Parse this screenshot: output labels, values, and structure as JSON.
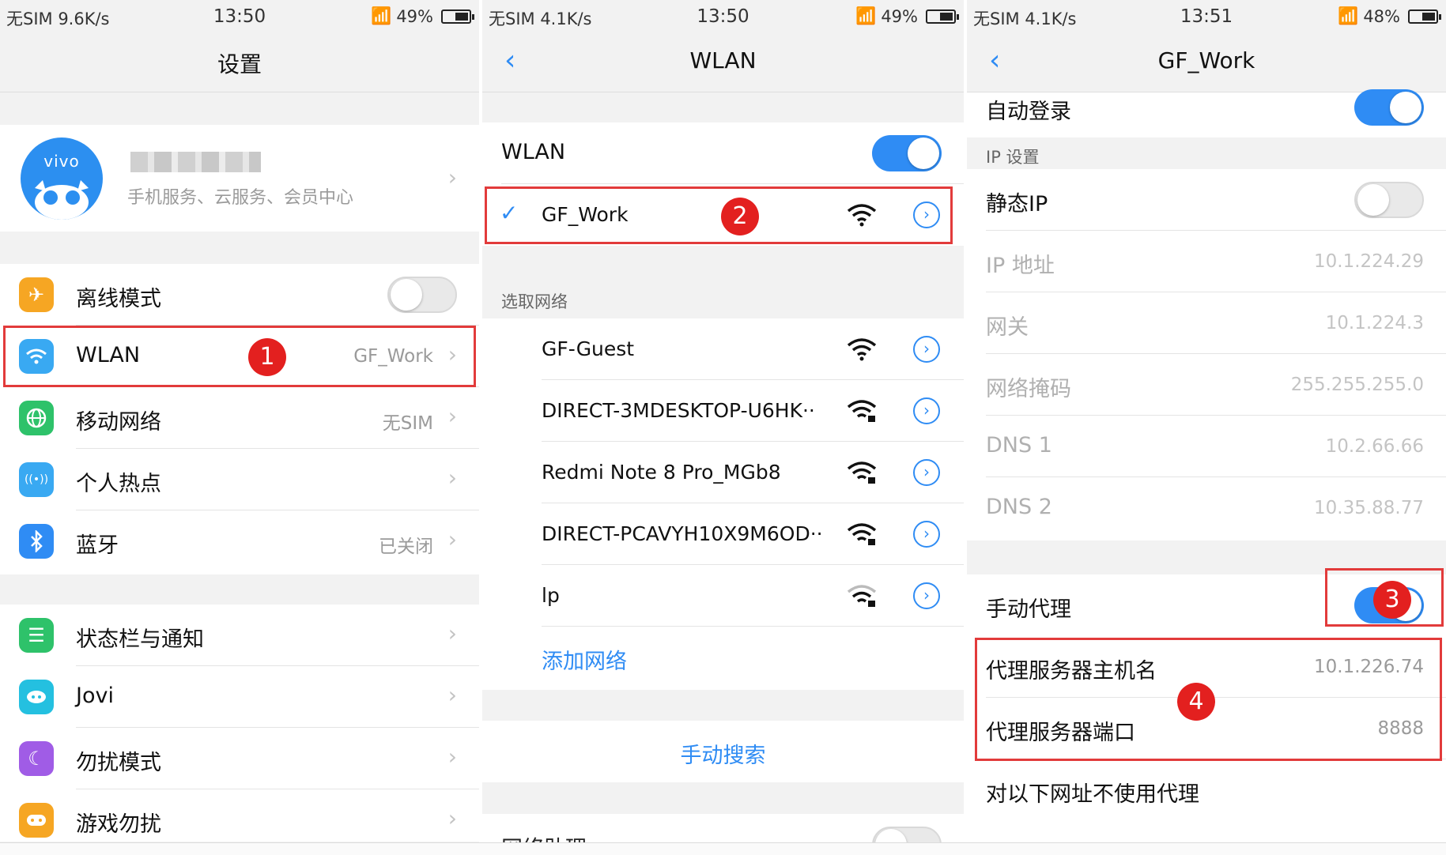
{
  "colors": {
    "accent": "#2f8cf4",
    "marker": "#e3201f",
    "outline": "#e23b3b"
  },
  "panel1": {
    "status": {
      "left": "无SIM 9.6K/s",
      "time": "13:50",
      "battery": "49%"
    },
    "title": "设置",
    "account": {
      "brand": "vivo",
      "subtitle": "手机服务、云服务、会员中心"
    },
    "items": [
      {
        "label": "离线模式",
        "icon": "airplane-icon"
      },
      {
        "label": "WLAN",
        "value": "GF_Work",
        "icon": "wifi-icon"
      },
      {
        "label": "移动网络",
        "value": "无SIM",
        "icon": "globe-icon"
      },
      {
        "label": "个人热点",
        "icon": "hotspot-icon"
      },
      {
        "label": "蓝牙",
        "value": "已关闭",
        "icon": "bluetooth-icon"
      },
      {
        "label": "状态栏与通知",
        "icon": "notification-icon"
      },
      {
        "label": "Jovi",
        "icon": "jovi-icon"
      },
      {
        "label": "勿扰模式",
        "icon": "moon-icon"
      },
      {
        "label": "游戏勿扰",
        "icon": "game-icon"
      }
    ],
    "badge": "1"
  },
  "panel2": {
    "status": {
      "left": "无SIM 4.1K/s",
      "time": "13:50",
      "battery": "49%"
    },
    "title": "WLAN",
    "wlan_label": "WLAN",
    "connected": "GF_Work",
    "section": "选取网络",
    "networks": [
      "GF-Guest",
      "DIRECT-3MDESKTOP-U6HK··",
      "Redmi Note 8 Pro_MGb8",
      "DIRECT-PCAVYH10X9M6OD··",
      "lp"
    ],
    "add_network": "添加网络",
    "manual_search": "手动搜索",
    "assistant": "网络助理",
    "badge": "2"
  },
  "panel3": {
    "status": {
      "left": "无SIM 4.1K/s",
      "time": "13:51",
      "battery": "48%"
    },
    "title": "GF_Work",
    "auto_login": "自动登录",
    "ip_section": "IP 设置",
    "static_ip": "静态IP",
    "fields": [
      {
        "label": "IP 地址",
        "value": "10.1.224.29"
      },
      {
        "label": "网关",
        "value": "10.1.224.3"
      },
      {
        "label": "网络掩码",
        "value": "255.255.255.0"
      },
      {
        "label": "DNS 1",
        "value": "10.2.66.66"
      },
      {
        "label": "DNS 2",
        "value": "10.35.88.77"
      }
    ],
    "manual_proxy": "手动代理",
    "proxy_host": {
      "label": "代理服务器主机名",
      "value": "10.1.226.74"
    },
    "proxy_port": {
      "label": "代理服务器端口",
      "value": "8888"
    },
    "bypass": "对以下网址不使用代理",
    "badge3": "3",
    "badge4": "4"
  }
}
